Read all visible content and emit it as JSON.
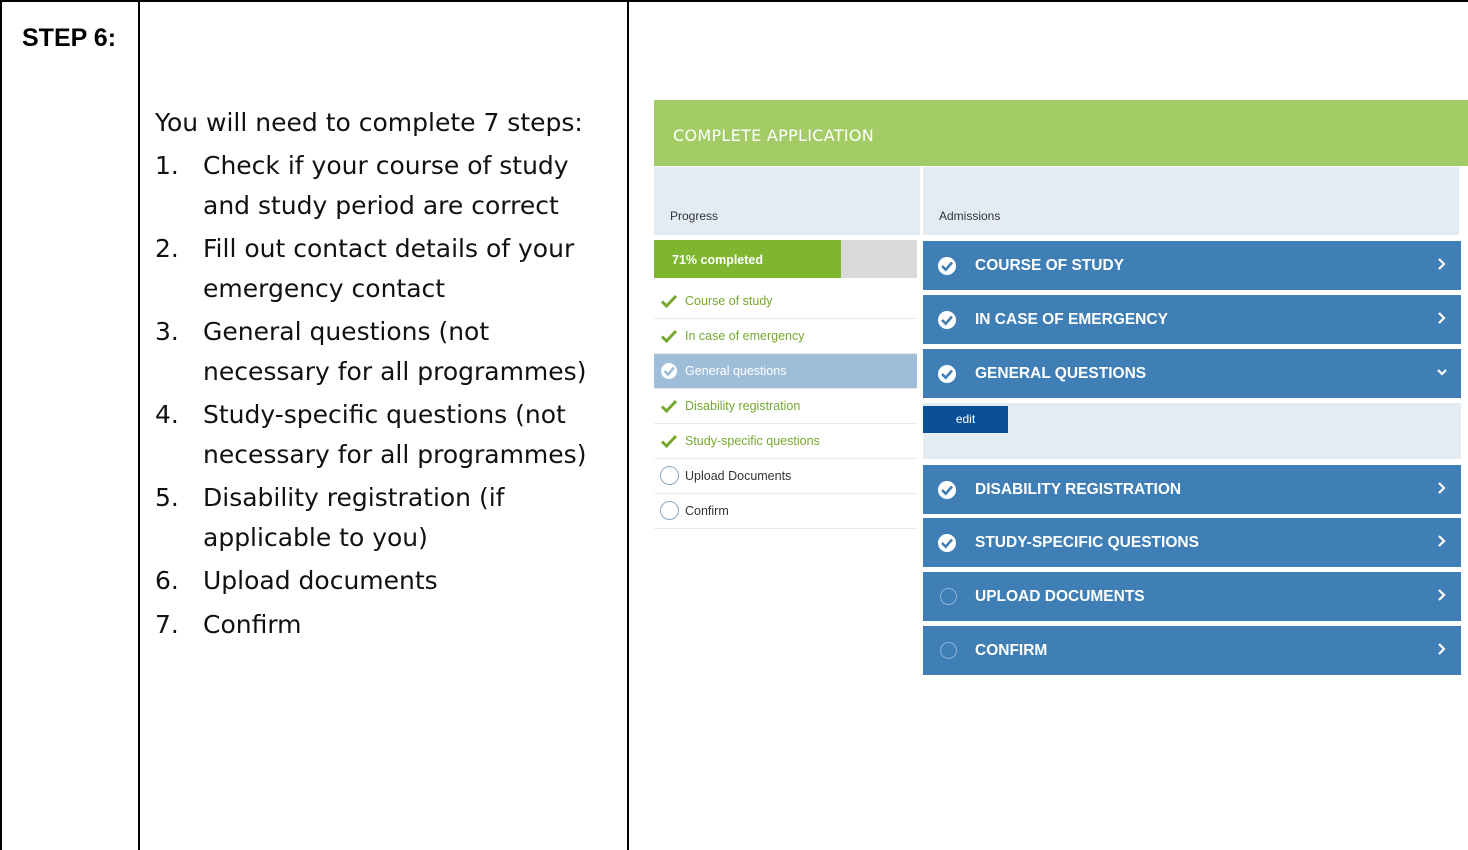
{
  "document": {
    "step_label": "STEP 6:",
    "intro": "You will need to complete 7 steps:",
    "steps": [
      {
        "num": "1.",
        "text": "Check if your course of study and study period are correct"
      },
      {
        "num": "2.",
        "text": "Fill out contact details of your emergency contact"
      },
      {
        "num": "3.",
        "text": "General questions (not necessary for all programmes)"
      },
      {
        "num": "4.",
        "text": "Study-specific questions (not necessary for all programmes)"
      },
      {
        "num": "5.",
        "text": "Disability registration (if applicable to you)"
      },
      {
        "num": "6.",
        "text": "Upload documents"
      },
      {
        "num": "7.",
        "text": "Confirm"
      }
    ]
  },
  "app": {
    "title": "COMPLETE APPLICATION",
    "colors": {
      "header": "#a3cc67",
      "accordion": "#3f7fb6",
      "progress_fill": "#7eb62f",
      "done_text": "#76a82f",
      "active_item": "#9dbdd9",
      "edit_button": "#0b4f96"
    },
    "progress": {
      "heading": "Progress",
      "label": "71% completed",
      "fraction": 0.71,
      "items": [
        {
          "label": "Course of study",
          "status": "done",
          "icon": "check-icon"
        },
        {
          "label": "In case of emergency",
          "status": "done",
          "icon": "check-icon"
        },
        {
          "label": "General questions",
          "status": "active",
          "icon": "check-circle-icon"
        },
        {
          "label": "Disability registration",
          "status": "done",
          "icon": "check-icon"
        },
        {
          "label": "Study-specific questions",
          "status": "done",
          "icon": "check-icon"
        },
        {
          "label": "Upload Documents",
          "status": "todo",
          "icon": "empty-circle-icon"
        },
        {
          "label": "Confirm",
          "status": "todo",
          "icon": "empty-circle-icon"
        }
      ]
    },
    "admissions": {
      "heading": "Admissions",
      "edit_label": "edit",
      "sections": [
        {
          "label": "COURSE OF STUDY",
          "status": "done",
          "chevron": "chevron-right-icon"
        },
        {
          "label": "IN CASE OF EMERGENCY",
          "status": "done",
          "chevron": "chevron-right-icon"
        },
        {
          "label": "GENERAL QUESTIONS",
          "status": "done",
          "chevron": "chevron-down-icon"
        },
        {
          "label": "DISABILITY REGISTRATION",
          "status": "done",
          "chevron": "chevron-right-icon"
        },
        {
          "label": "STUDY-SPECIFIC QUESTIONS",
          "status": "done",
          "chevron": "chevron-right-icon"
        },
        {
          "label": "UPLOAD DOCUMENTS",
          "status": "todo",
          "chevron": "chevron-right-icon"
        },
        {
          "label": "CONFIRM",
          "status": "todo",
          "chevron": "chevron-right-icon"
        }
      ]
    }
  }
}
